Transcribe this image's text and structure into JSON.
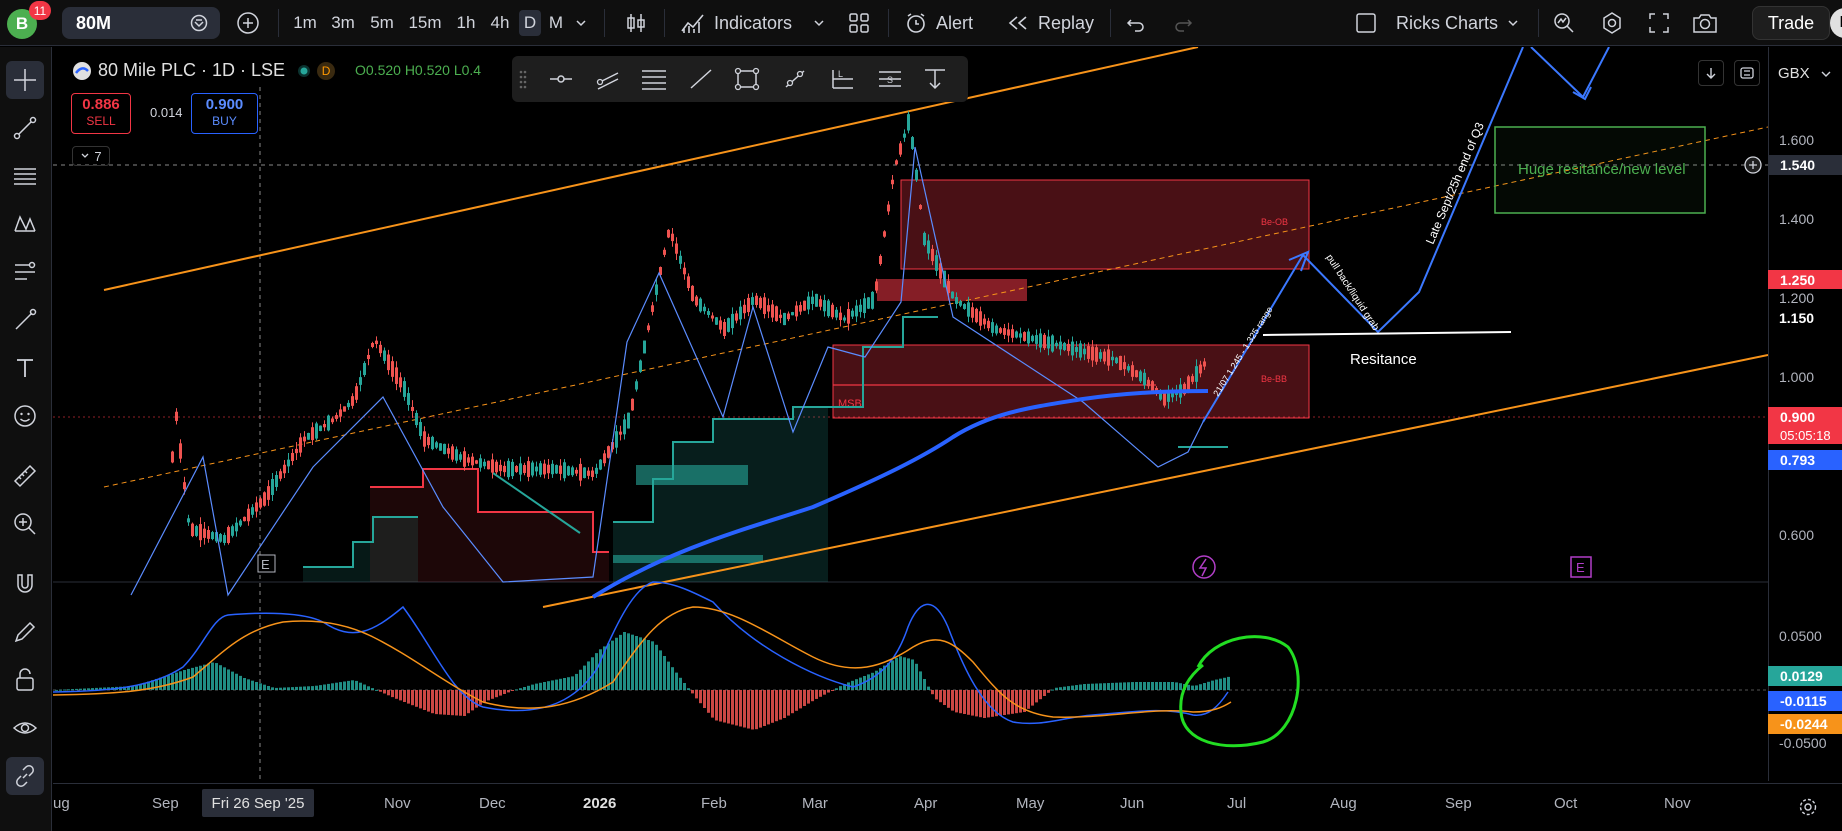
{
  "topbar": {
    "avatar_letter": "B",
    "notifications": "11",
    "symbol": "80M",
    "timeframes": [
      "1m",
      "3m",
      "5m",
      "15m",
      "1h",
      "4h",
      "D",
      "M"
    ],
    "active_timeframe": "D",
    "indicators_label": "Indicators",
    "alert_label": "Alert",
    "replay_label": "Replay",
    "layout_name": "Ricks Charts",
    "trade_label": "Trade",
    "profile_letter": "P"
  },
  "legend": {
    "title": "80 Mile PLC · 1D · LSE",
    "badge": "D",
    "ohlc": "O0.520  H0.520  L0.4",
    "sell_price": "0.886",
    "sell_label": "SELL",
    "spread": "0.014",
    "buy_price": "0.900",
    "buy_label": "BUY",
    "collapsed_count": "7"
  },
  "price_axis": {
    "currency": "GBX",
    "labels": [
      "1.600",
      "1.400",
      "1.200",
      "1.000",
      "0.600"
    ],
    "crosshair_price": "1.540",
    "tag_1250": "1.250",
    "label_1150": "1.150",
    "last_price": "0.900",
    "countdown": "05:05:18",
    "ma_price": "0.793",
    "macd_labels": [
      "0.0500",
      "-0.0500"
    ],
    "macd_hist": "0.0129",
    "macd_line": "-0.0115",
    "macd_signal": "-0.0244"
  },
  "time_axis": {
    "labels": [
      {
        "text": "ug",
        "bold": false
      },
      {
        "text": "Sep",
        "bold": false
      },
      {
        "text": "Nov",
        "bold": false
      },
      {
        "text": "Dec",
        "bold": false
      },
      {
        "text": "2026",
        "bold": true
      },
      {
        "text": "Feb",
        "bold": false
      },
      {
        "text": "Mar",
        "bold": false
      },
      {
        "text": "Apr",
        "bold": false
      },
      {
        "text": "May",
        "bold": false
      },
      {
        "text": "Jun",
        "bold": false
      },
      {
        "text": "Jul",
        "bold": false
      },
      {
        "text": "Aug",
        "bold": false
      },
      {
        "text": "Sep",
        "bold": false
      },
      {
        "text": "Oct",
        "bold": false
      },
      {
        "text": "Nov",
        "bold": false
      }
    ],
    "cursor_date": "Fri 26 Sep '25"
  },
  "annotations": {
    "huge_resistance": "Huge resitance/new level",
    "resistance": "Resitance",
    "late_sept": "Late Sept/25h end of Q3",
    "pullback": "pull back/liquid grab",
    "range": "21/07 1.245 - 1.325 range",
    "be_ob": "Be-OB",
    "be_bb": "Be-BB",
    "msb": "MSB",
    "marker_e": "E"
  },
  "colors": {
    "bull": "#26a69a",
    "bear": "#ef5350",
    "orange": "#f7931a",
    "blue": "#2962ff",
    "green_box": "#4caf50"
  }
}
